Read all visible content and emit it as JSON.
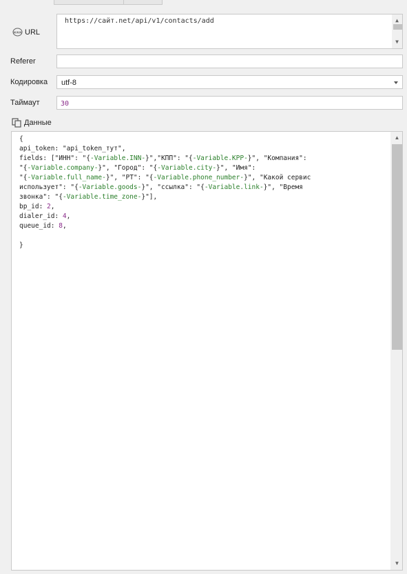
{
  "url": {
    "label": "URL",
    "value": "https://сайт.net/api/v1/contacts/add"
  },
  "referer": {
    "label": "Referer",
    "value": ""
  },
  "encoding": {
    "label": "Кодировка",
    "value": "utf-8"
  },
  "timeout": {
    "label": "Таймаут",
    "value": "30"
  },
  "data": {
    "label": "Данные",
    "lines": [
      "{",
      "api_token: \"api_token_тут\",",
      "fields: [\"ИНН\": \"{-Variable.INN-}\",\"КПП\": \"{-Variable.KPP-}\", \"Компания\":",
      "\"{-Variable.company-}\", \"Город\": \"{-Variable.city-}\", \"Имя\":",
      "\"{-Variable.full_name-}\", \"РТ\": \"{-Variable.phone_number-}\", \"Какой сервис",
      "использует\": \"{-Variable.goods-}\", \"ссылка\": \"{-Variable.link-}\", \"Время",
      "звонка\": \"{-Variable.time_zone-}\"],",
      "bp_id: 2,",
      "dialer_id: 4,",
      "queue_id: 8,",
      "",
      "}"
    ]
  },
  "icons": {
    "url": "globe-www-icon",
    "data": "copy-pages-icon",
    "dropdown": "chevron-down-icon"
  },
  "colors": {
    "variable": "#2a7f2a",
    "number": "#8a2b8a"
  }
}
